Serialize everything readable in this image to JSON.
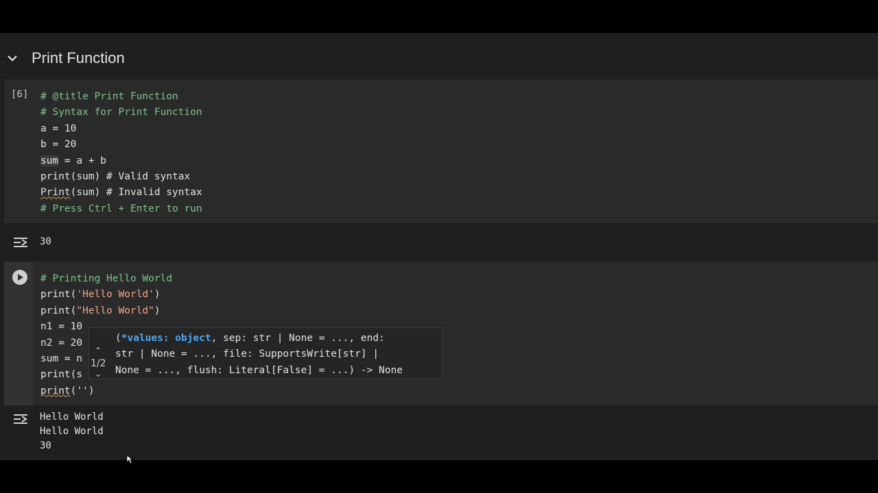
{
  "section": {
    "title": "Print Function"
  },
  "cell1": {
    "exec_count": "[6]",
    "lines": [
      "# @title Print Function",
      "# Syntax for Print Function",
      "a = 10",
      "b = 20",
      "sum",
      " = a + b",
      "print(sum) # Valid syntax",
      "Print",
      "(sum) # Invalid syntax",
      "# Press Ctrl + Enter to run"
    ]
  },
  "output1": {
    "text": "30"
  },
  "cell2": {
    "line1": "# Printing Hello World",
    "line2_fn": "print(",
    "line2_str": "'Hello World'",
    "line2_end": ")",
    "line3_fn": "print(",
    "line3_str": "\"Hello World\"",
    "line3_end": ")",
    "line4": "n1 = 10",
    "line5": "n2 = 20",
    "line6": "sum = n",
    "line7": "print(s",
    "line8_fn": "print",
    "line8_rest": "('')"
  },
  "signature_help": {
    "counter": "1/2",
    "line1_open": "(",
    "line1_active": "*values: object",
    "line1_rest": ", sep: str | None = ..., end:",
    "line2": "str | None = ..., file: SupportsWrite[str] |",
    "line3": "None = ..., flush: Literal[False] = ...) -> None"
  },
  "output2": {
    "lines": [
      "Hello World",
      "Hello World",
      "30"
    ]
  },
  "icons": {
    "collapse": "chevron-down-icon",
    "run": "play-icon",
    "output": "output-toggle-icon",
    "cursor": "mouse-pointer-icon"
  }
}
